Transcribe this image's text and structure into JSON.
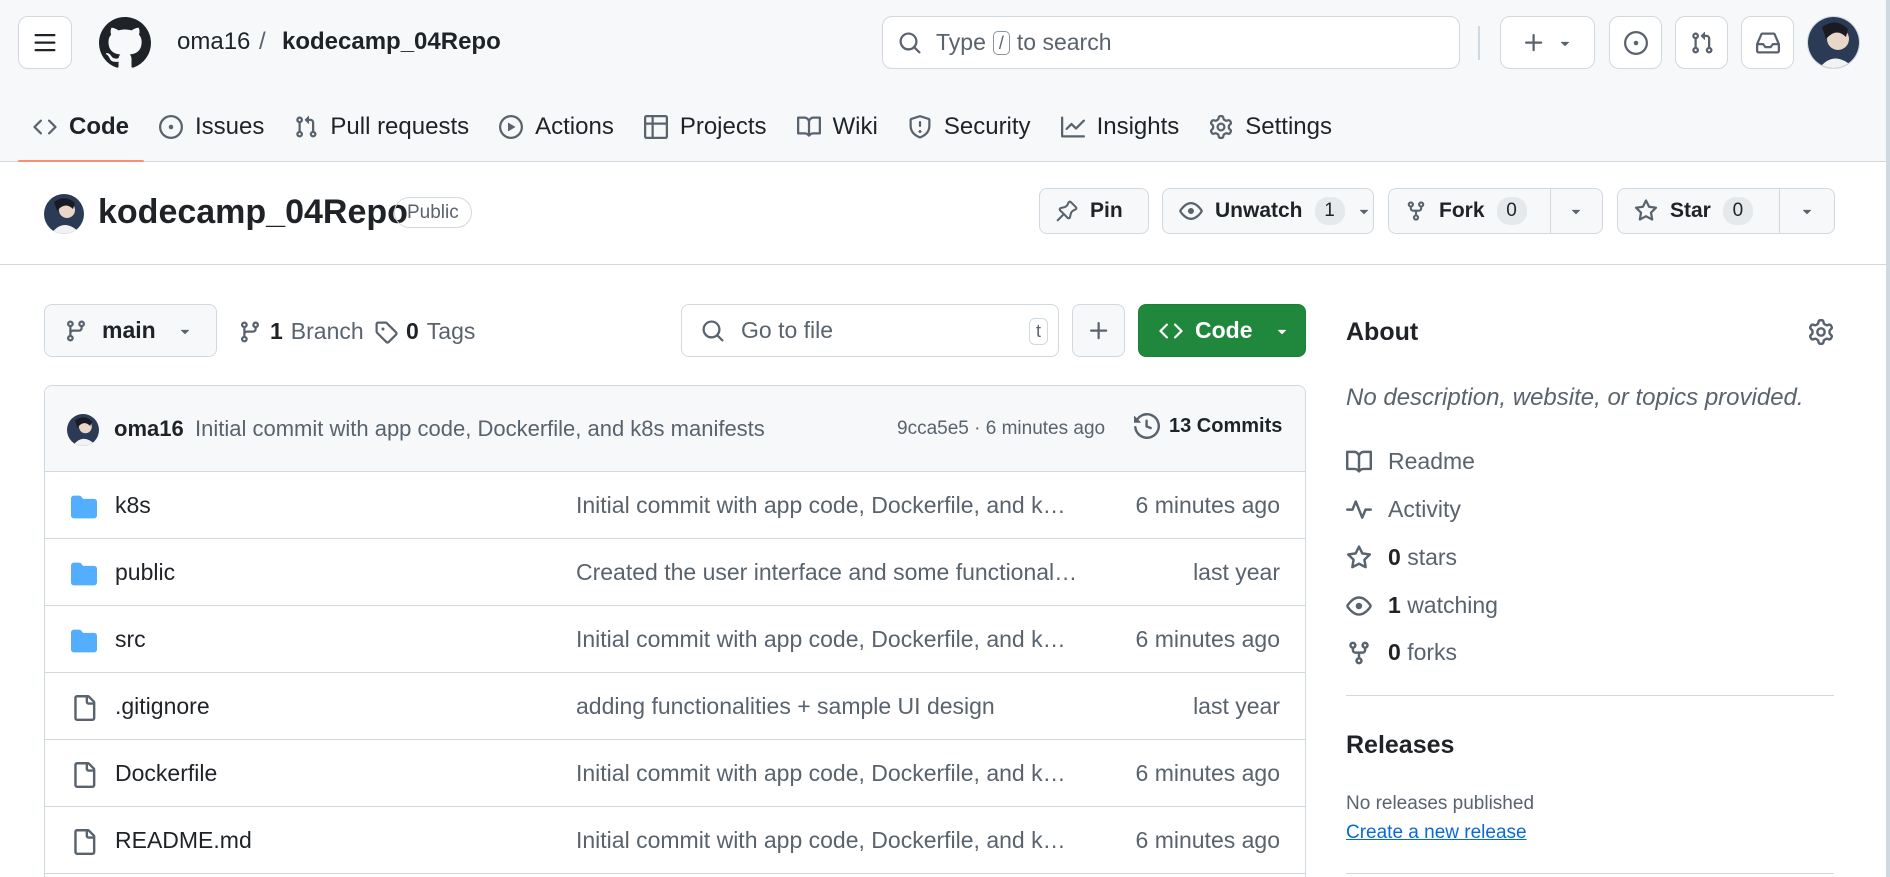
{
  "header": {
    "owner": "oma16",
    "separator": "/",
    "repo": "kodecamp_04Repo",
    "search": {
      "prefix": "Type",
      "key": "/",
      "suffix": "to search"
    }
  },
  "tabs": [
    {
      "label": "Code",
      "icon": "code-icon",
      "active": true
    },
    {
      "label": "Issues",
      "icon": "issue-icon"
    },
    {
      "label": "Pull requests",
      "icon": "pull-request-icon"
    },
    {
      "label": "Actions",
      "icon": "play-icon"
    },
    {
      "label": "Projects",
      "icon": "table-icon"
    },
    {
      "label": "Wiki",
      "icon": "book-icon"
    },
    {
      "label": "Security",
      "icon": "shield-icon"
    },
    {
      "label": "Insights",
      "icon": "graph-icon"
    },
    {
      "label": "Settings",
      "icon": "gear-icon"
    }
  ],
  "repo_header": {
    "name": "kodecamp_04Repo",
    "visibility": "Public",
    "pin_label": "Pin",
    "unwatch_label": "Unwatch",
    "watch_count": "1",
    "fork_label": "Fork",
    "fork_count": "0",
    "star_label": "Star",
    "star_count": "0"
  },
  "toolbar": {
    "branch": "main",
    "branches_count": "1",
    "branches_label": "Branch",
    "tags_count": "0",
    "tags_label": "Tags",
    "goto_placeholder": "Go to file",
    "goto_key": "t",
    "code_label": "Code"
  },
  "latest_commit": {
    "author": "oma16",
    "message": "Initial commit with app code, Dockerfile, and k8s manifests",
    "hash": "9cca5e5",
    "dot": "·",
    "time": "6 minutes ago",
    "commits_label": "13 Commits"
  },
  "files": [
    {
      "type": "folder",
      "name": "k8s",
      "message": "Initial commit with app code, Dockerfile, and k8s manifests",
      "time": "6 minutes ago"
    },
    {
      "type": "folder",
      "name": "public",
      "message": "Created the user interface and some functionalities",
      "time": "last year"
    },
    {
      "type": "folder",
      "name": "src",
      "message": "Initial commit with app code, Dockerfile, and k8s manifests",
      "time": "6 minutes ago"
    },
    {
      "type": "file",
      "name": ".gitignore",
      "message": "adding functionalities + sample UI design",
      "time": "last year"
    },
    {
      "type": "file",
      "name": "Dockerfile",
      "message": "Initial commit with app code, Dockerfile, and k8s manifests",
      "time": "6 minutes ago"
    },
    {
      "type": "file",
      "name": "README.md",
      "message": "Initial commit with app code, Dockerfile, and k8s manifests",
      "time": "6 minutes ago"
    }
  ],
  "about": {
    "title": "About",
    "description": "No description, website, or topics provided.",
    "readme": "Readme",
    "activity": "Activity",
    "stars_count": "0",
    "stars_label": "stars",
    "watching_count": "1",
    "watching_label": "watching",
    "forks_count": "0",
    "forks_label": "forks"
  },
  "releases": {
    "title": "Releases",
    "none": "No releases published",
    "create_link": "Create a new release"
  },
  "colors": {
    "accent_green": "#1f883d",
    "link_blue": "#0969da",
    "tab_underline": "#fd8c73",
    "folder_blue": "#54aeff"
  }
}
